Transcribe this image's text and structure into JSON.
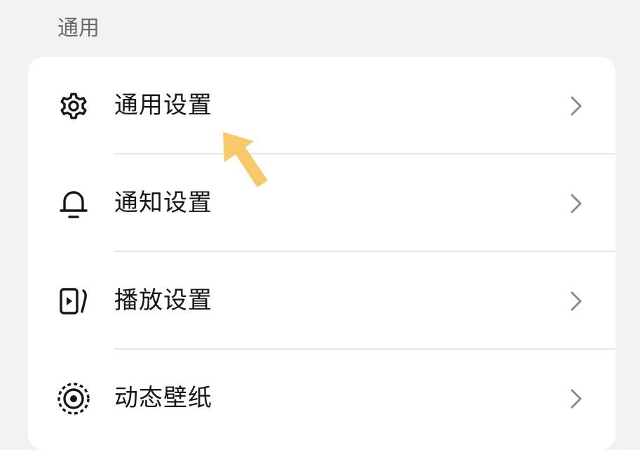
{
  "section": {
    "title": "通用"
  },
  "menu": {
    "items": [
      {
        "label": "通用设置",
        "icon": "gear-icon"
      },
      {
        "label": "通知设置",
        "icon": "bell-icon"
      },
      {
        "label": "播放设置",
        "icon": "play-screen-icon"
      },
      {
        "label": "动态壁纸",
        "icon": "live-wallpaper-icon"
      }
    ]
  },
  "colors": {
    "background": "#f2f2f2",
    "card": "#ffffff",
    "text": "#161616",
    "section_title": "#6a6a6a",
    "divider": "#e6e6e6",
    "chevron": "#8a8a8a",
    "highlight_arrow": "#f7c96b"
  }
}
